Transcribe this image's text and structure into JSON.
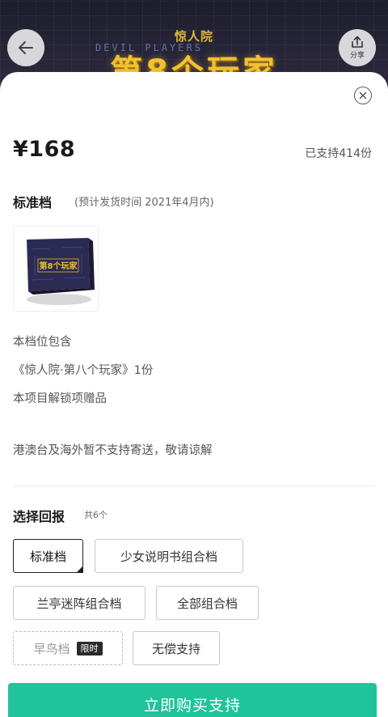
{
  "banner": {
    "subtitle": "惊人院",
    "deco_text": "DEVIL PLAYERS",
    "title": "第8个玩家"
  },
  "header": {
    "share_label": "分享"
  },
  "sheet": {
    "price": "¥168",
    "backers": "已支持414份",
    "tier_title": "标准档",
    "ship_time": "(预计发货时间 2021年4月内)",
    "product_logo_text": "第8个玩家",
    "includes_head": "本档位包含",
    "includes": [
      "《惊人院·第八个玩家》1份",
      "本项目解锁项赠品"
    ],
    "notice": "港澳台及海外暂不支持寄送，敬请谅解",
    "choose_title": "选择回报",
    "choose_count": "共6个",
    "options": [
      {
        "label": "标准档",
        "state": "selected"
      },
      {
        "label": "少女说明书组合档",
        "state": "normal"
      },
      {
        "label": "兰亭迷阵组合档",
        "state": "normal"
      },
      {
        "label": "全部组合档",
        "state": "normal"
      },
      {
        "label": "早鸟档",
        "state": "disabled",
        "badge": "限时"
      },
      {
        "label": "无偿支持",
        "state": "normal"
      }
    ],
    "buy_label": "立即购买支持"
  },
  "colors": {
    "accent": "#20c39a",
    "banner_title": "#f1c230",
    "banner_bg": "#262538"
  },
  "icons": [
    "back-arrow-icon",
    "share-icon",
    "close-icon"
  ]
}
